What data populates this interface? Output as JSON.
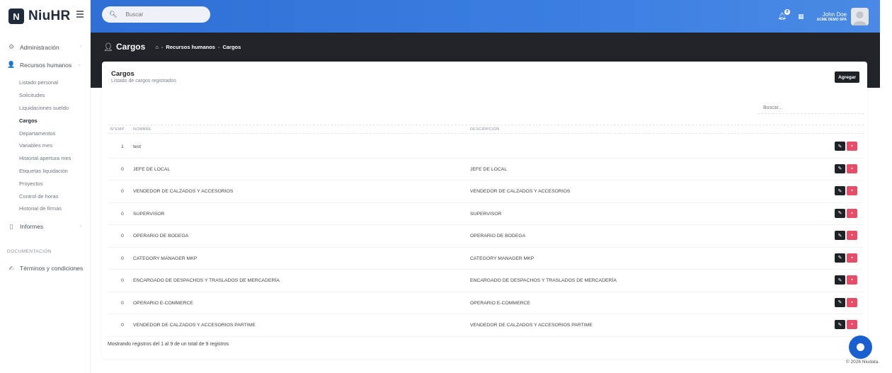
{
  "brand": {
    "logo_letter": "N",
    "name": "NiuHR"
  },
  "header": {
    "search_placeholder": "Buscar",
    "notification_count": "8",
    "user_name": "John Doe",
    "company": "ACME DEMO SPA"
  },
  "sidebar": {
    "groups": [
      {
        "label": "Administración",
        "icon": "gears-icon"
      },
      {
        "label": "Recursos humanos",
        "icon": "users-icon"
      }
    ],
    "sub_items": [
      "Listado personal",
      "Solicitudes",
      "Liquidaciones sueldo",
      "Cargos",
      "Departamentos",
      "Variables mes",
      "Historial apertura mes",
      "Etiquetas liquidación",
      "Proyectos",
      "Control de horas",
      "Historial de firmas"
    ],
    "active_item": "Cargos",
    "informes": "Informes",
    "section_label": "DOCUMENTACIÓN",
    "terms": "Términos y condiciones"
  },
  "page": {
    "title": "Cargos",
    "breadcrumb": [
      "Recursos humanos",
      "Cargos"
    ]
  },
  "card": {
    "title": "Cargos",
    "subtitle": "Listado de cargos registrados",
    "add_label": "Agregar",
    "search_placeholder": "Buscar...",
    "columns": [
      "N°EMP.",
      "NOMBRE",
      "DESCRIPCIÓN"
    ],
    "rows": [
      {
        "count": "1",
        "name": "test",
        "description": ""
      },
      {
        "count": "0",
        "name": "JEFE DE LOCAL",
        "description": "JEFE DE LOCAL"
      },
      {
        "count": "0",
        "name": "VENDEDOR DE CALZADOS Y ACCESORIOS",
        "description": "VENDEDOR DE CALZADOS Y ACCESORIOS"
      },
      {
        "count": "0",
        "name": "SUPERVISOR",
        "description": "SUPERVISOR"
      },
      {
        "count": "0",
        "name": "OPERARIO DE BODEGA",
        "description": "OPERARIO DE BODEGA"
      },
      {
        "count": "0",
        "name": "CATEGORY MANAGER MKP",
        "description": "CATEGORY MANAGER MKP"
      },
      {
        "count": "0",
        "name": "ENCARGADO DE DESPACHOS Y TRASLADOS DE MERCADERÍA",
        "description": "ENCARGADO DE DESPACHOS Y TRASLADOS DE MERCADERÍA"
      },
      {
        "count": "0",
        "name": "OPERARIO E-COMMERCE",
        "description": "OPERARIO E-COMMERCE"
      },
      {
        "count": "0",
        "name": "VENDEDOR DE CALZADOS Y ACCESORIOS PARTIME",
        "description": "VENDEDOR DE CALZADOS Y ACCESORIOS PARTIME"
      }
    ],
    "footer_info": "Mostrando registros del 1 al 9 de un total de 9 registros"
  },
  "copyright": "© 2026 Niudata.",
  "colors": {
    "header_blue": "#3b7ee0",
    "dark_band": "#202328",
    "delete_red": "#e74c68",
    "fab_blue": "#1a5fd0"
  }
}
